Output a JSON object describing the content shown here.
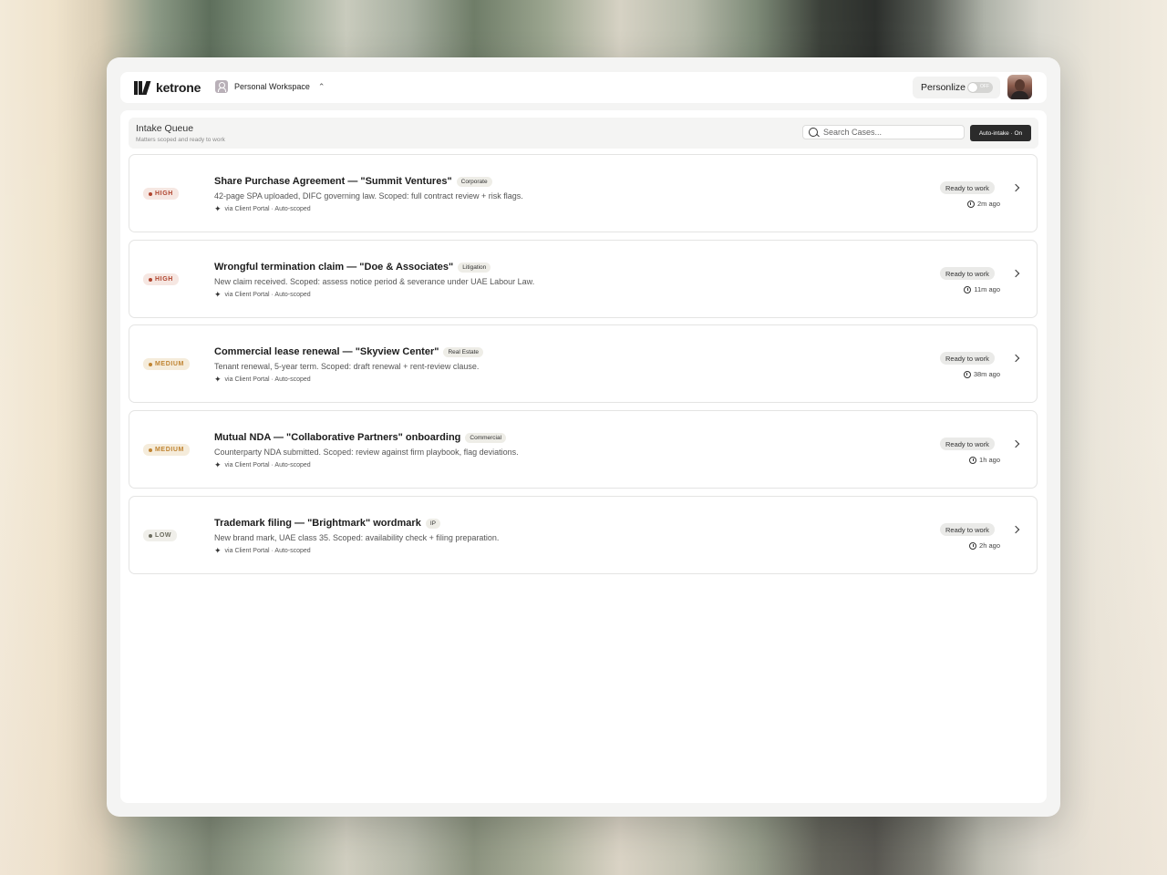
{
  "app": {
    "logo_text": "ketrone",
    "workspace": "Personal Workspace",
    "personalize_label": "Personlize",
    "toggle_state": "OFF"
  },
  "queue": {
    "title": "Intake Queue",
    "subtitle": "Matters scoped and ready to work",
    "search_placeholder": "Search Cases...",
    "auto_intake_label": "Auto-intake · On"
  },
  "cases": [
    {
      "priority": "HIGH",
      "priority_level": "high",
      "title": "Share Purchase Agreement — \"Summit Ventures\"",
      "tag": "Corporate",
      "description": "42-page SPA uploaded, DIFC governing law. Scoped: full contract review + risk flags.",
      "source": "via Client Portal · Auto-scoped",
      "status": "Ready to work",
      "time": "2m ago"
    },
    {
      "priority": "HIGH",
      "priority_level": "high",
      "title": "Wrongful termination claim — \"Doe & Associates\"",
      "tag": "Litigation",
      "description": "New claim received. Scoped: assess notice period & severance under UAE Labour Law.",
      "source": "via Client Portal · Auto-scoped",
      "status": "Ready to work",
      "time": "11m ago"
    },
    {
      "priority": "MEDIUM",
      "priority_level": "medium",
      "title": "Commercial lease renewal — \"Skyview Center\"",
      "tag": "Real Estate",
      "description": "Tenant renewal, 5-year term. Scoped: draft renewal + rent-review clause.",
      "source": "via Client Portal · Auto-scoped",
      "status": "Ready to work",
      "time": "38m ago"
    },
    {
      "priority": "MEDIUM",
      "priority_level": "medium",
      "title": "Mutual NDA — \"Collaborative Partners\" onboarding",
      "tag": "Commercial",
      "description": "Counterparty NDA submitted. Scoped: review against firm playbook, flag deviations.",
      "source": "via Client Portal · Auto-scoped",
      "status": "Ready to work",
      "time": "1h ago"
    },
    {
      "priority": "LOW",
      "priority_level": "low",
      "title": "Trademark filing — \"Brightmark\" wordmark",
      "tag": "IP",
      "description": "New brand mark, UAE class 35. Scoped: availability check + filing preparation.",
      "source": "via Client Portal · Auto-scoped",
      "status": "Ready to work",
      "time": "2h ago"
    }
  ]
}
